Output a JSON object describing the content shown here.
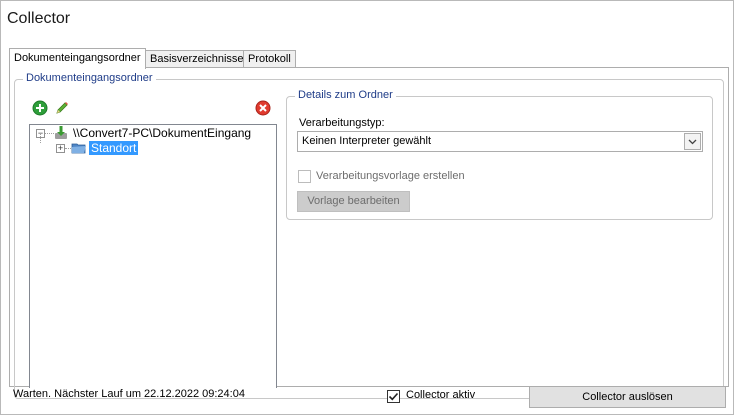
{
  "window": {
    "title": "Collector"
  },
  "tabs": [
    {
      "label": "Dokumenteingangsordner",
      "active": true
    },
    {
      "label": "Basisverzeichnisse",
      "active": false
    },
    {
      "label": "Protokoll",
      "active": false
    }
  ],
  "folder_group": {
    "legend": "Dokumenteingangsordner"
  },
  "toolbar": {
    "add_icon": "add-icon",
    "edit_icon": "pencil-icon",
    "delete_icon": "delete-icon"
  },
  "tree": {
    "root": {
      "label": "\\\\Convert7-PC\\DokumentEingang",
      "expanded": true
    },
    "children": [
      {
        "label": "Standort",
        "selected": true,
        "expanded": false
      }
    ]
  },
  "details": {
    "legend": "Details zum Ordner",
    "type_label": "Verarbeitungstyp:",
    "type_value": "Keinen Interpreter gewählt",
    "create_template_label": "Verarbeitungsvorlage erstellen",
    "create_template_checked": false,
    "edit_template_button": "Vorlage bearbeiten"
  },
  "footer": {
    "status": "Warten. Nächster Lauf um 22.12.2022 09:24:04",
    "collector_active_label": "Collector aktiv",
    "collector_active_checked": true,
    "trigger_button": "Collector auslösen"
  },
  "colors": {
    "selection": "#3399ff",
    "legend_text": "#1f3c88",
    "add_green": "#2e9e3a",
    "delete_red": "#e03a2e"
  }
}
